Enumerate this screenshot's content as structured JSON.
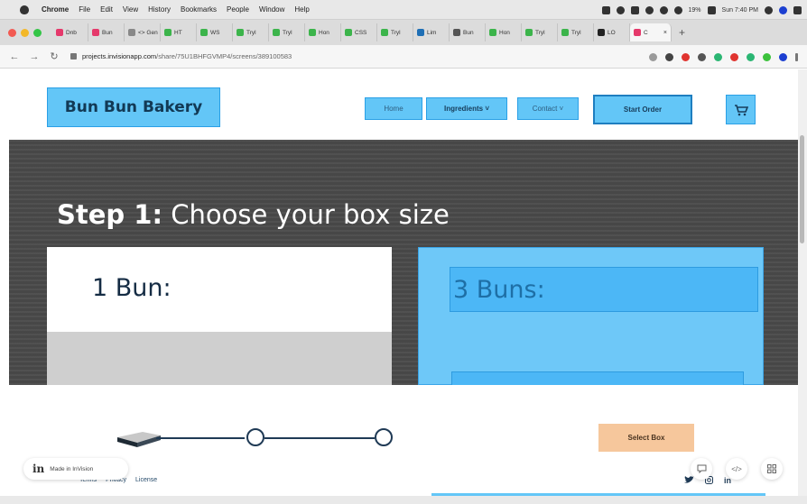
{
  "menubar": {
    "app": "Chrome",
    "items": [
      "File",
      "Edit",
      "View",
      "History",
      "Bookmarks",
      "People",
      "Window",
      "Help"
    ],
    "battery": "19%",
    "clock": "Sun 7:40 PM"
  },
  "tabs": [
    {
      "label": "Dnb",
      "color": "#e5396b"
    },
    {
      "label": "Bun",
      "color": "#e5396b"
    },
    {
      "label": "<> Gen",
      "color": "#888888"
    },
    {
      "label": "HT",
      "color": "#3cb44b"
    },
    {
      "label": "WS",
      "color": "#3cb44b"
    },
    {
      "label": "Tryl",
      "color": "#3cb44b"
    },
    {
      "label": "Tryl",
      "color": "#3cb44b"
    },
    {
      "label": "Hon",
      "color": "#3cb44b"
    },
    {
      "label": "CSS",
      "color": "#3cb44b"
    },
    {
      "label": "Tryl",
      "color": "#3cb44b"
    },
    {
      "label": "Lim",
      "color": "#1f6fb5"
    },
    {
      "label": "Bun",
      "color": "#555555"
    },
    {
      "label": "Hon",
      "color": "#3cb44b"
    },
    {
      "label": "Tryl",
      "color": "#3cb44b"
    },
    {
      "label": "Tryl",
      "color": "#3cb44b"
    },
    {
      "label": "LO",
      "color": "#222222"
    }
  ],
  "active_tab": {
    "label": "C",
    "color": "#e5396b"
  },
  "address": {
    "host": "projects.invisionapp.com",
    "path": "/share/75U1BHFGVMP4/screens/389100583"
  },
  "site": {
    "logo": "Bun Bun Bakery",
    "nav": {
      "home": "Home",
      "ingredients": "Ingredients ˅",
      "contact": "Contact ˅"
    },
    "start_order": "Start Order",
    "step_bold": "Step 1:",
    "step_text": " Choose your box size",
    "option_one": "1 Bun:",
    "option_three": "3 Buns:",
    "select_box": "Select Box",
    "footer_links": [
      "Terms",
      "Privacy",
      "License"
    ],
    "social": [
      "twitter",
      "instagram",
      "in"
    ]
  },
  "badge": {
    "text": "Made in InVision"
  },
  "colors": {
    "hotspot": "#63c6f7",
    "hero": "#4b4b4b",
    "select_box": "#f6c79c",
    "navy": "#152c44"
  }
}
